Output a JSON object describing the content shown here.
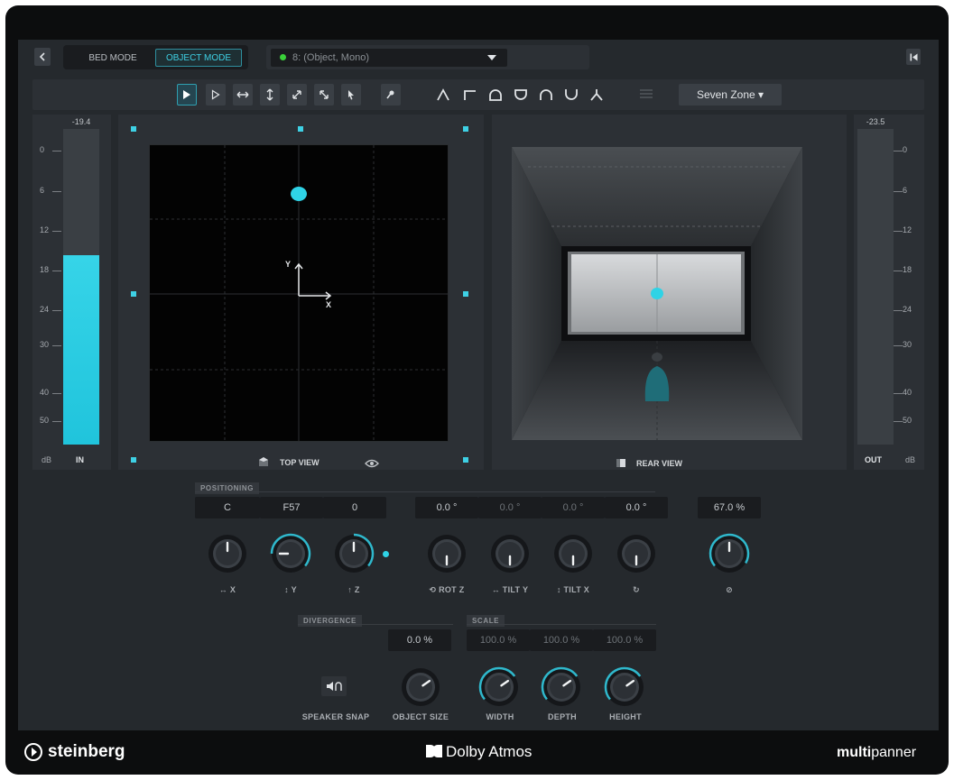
{
  "header": {
    "back_icon": "chevron-left-icon",
    "bed_mode_label": "BED MODE",
    "object_mode_label": "OBJECT MODE",
    "active_mode": "OBJECT MODE",
    "channel_select": "8: (Object, Mono)",
    "channel_status_color": "#3ad13a",
    "collapse_icon": "skip-back-icon"
  },
  "toolbar": {
    "tools": [
      "select-tool",
      "select-outline-tool",
      "horizontal-move-tool",
      "vertical-move-tool",
      "diagonal-move-tool",
      "diagonal-move-alt-tool",
      "pointer-tool",
      "pin-tool"
    ],
    "curves": [
      "peak-curve",
      "step-curve",
      "dome-curve",
      "bowl-curve",
      "arch-curve",
      "valley-curve",
      "split-curve"
    ],
    "zone_select": "Seven Zone ▾"
  },
  "meters": {
    "in": {
      "peak": "-19.4",
      "scale": [
        "0",
        "6",
        "12",
        "18",
        "24",
        "30",
        "40",
        "50"
      ],
      "unit": "dB",
      "label": "IN",
      "level": 0.6
    },
    "out": {
      "peak": "-23.5",
      "scale": [
        "0",
        "6",
        "12",
        "18",
        "24",
        "30",
        "40",
        "50"
      ],
      "unit": "dB",
      "label": "OUT",
      "level": 0.0
    }
  },
  "views": {
    "top": {
      "label": "TOP VIEW",
      "axis_y": "Y",
      "axis_x": "X"
    },
    "rear": {
      "label": "REAR VIEW"
    }
  },
  "positioning": {
    "title": "POSITIONING",
    "fields": [
      "C",
      "F57",
      "0"
    ],
    "rotation_fields": [
      "0.0 °",
      "0.0 °",
      "0.0 °",
      "0.0 °"
    ],
    "size_field": "67.0 %",
    "knob_labels": [
      "↔ X",
      "↕ Y",
      "↑ Z",
      "⟲ ROT Z",
      "↔ TILT Y",
      "↕ TILT X",
      "↻",
      "⊘"
    ]
  },
  "divergence": {
    "title": "DIVERGENCE",
    "value": "0.0 %"
  },
  "scale": {
    "title": "SCALE",
    "values": [
      "100.0 %",
      "100.0 %",
      "100.0 %"
    ]
  },
  "bottom_controls": {
    "speaker_snap": "SPEAKER SNAP",
    "object_size": "OBJECT SIZE",
    "width": "WIDTH",
    "depth": "DEPTH",
    "height": "HEIGHT"
  },
  "footer": {
    "brand_left": "steinberg",
    "brand_center": "Dolby Atmos",
    "brand_right_bold": "multi",
    "brand_right_rest": "panner"
  },
  "colors": {
    "accent": "#2fd3e6",
    "meter_fill": "#2fd3e6"
  }
}
